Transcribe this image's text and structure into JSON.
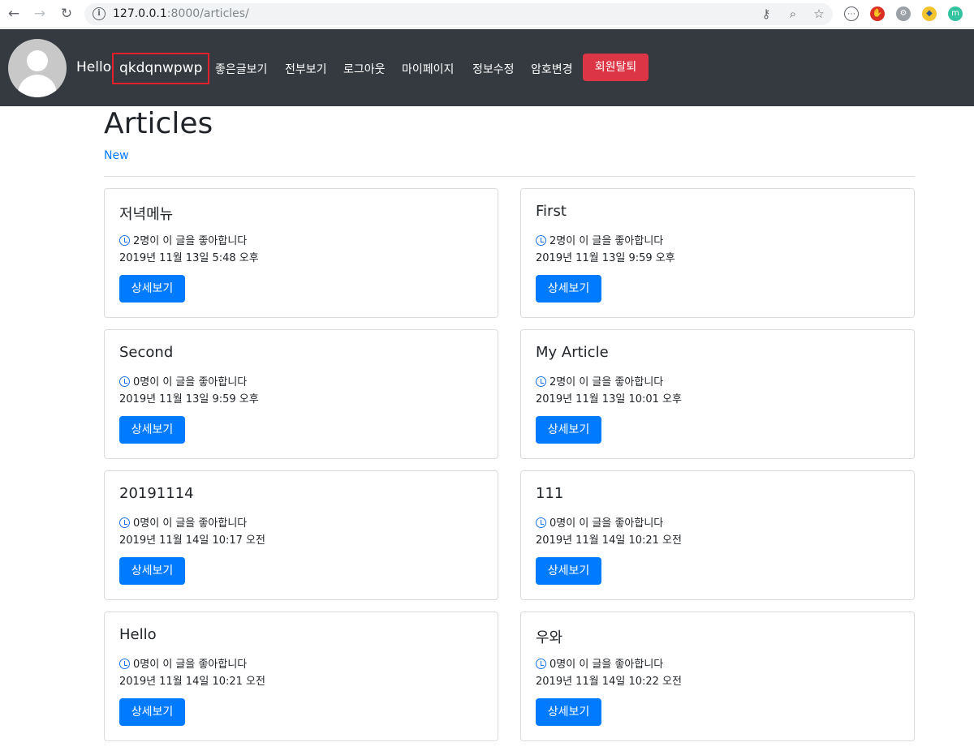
{
  "browser": {
    "url_host": "127.0.0.1",
    "url_rest": ":8000/articles/"
  },
  "navbar": {
    "hello": "Hello",
    "username": "qkdqnwpwp",
    "links": [
      "좋은글보기",
      "전부보기",
      "로그아웃",
      "마이페이지",
      "정보수정",
      "암호변경"
    ],
    "delete_label": "회원탈퇴"
  },
  "main": {
    "title": "Articles",
    "new_label": "New"
  },
  "articles": [
    {
      "title": "저녁메뉴",
      "likes": "2명이 이 글을 좋아합니다",
      "date": "2019년 11월 13일 5:48 오후",
      "button": "상세보기"
    },
    {
      "title": "First",
      "likes": "2명이 이 글을 좋아합니다",
      "date": "2019년 11월 13일 9:59 오후",
      "button": "상세보기"
    },
    {
      "title": "Second",
      "likes": "0명이 이 글을 좋아합니다",
      "date": "2019년 11월 13일 9:59 오후",
      "button": "상세보기"
    },
    {
      "title": "My Article",
      "likes": "2명이 이 글을 좋아합니다",
      "date": "2019년 11월 13일 10:01 오후",
      "button": "상세보기"
    },
    {
      "title": "20191114",
      "likes": "0명이 이 글을 좋아합니다",
      "date": "2019년 11월 14일 10:17 오전",
      "button": "상세보기"
    },
    {
      "title": "111",
      "likes": "0명이 이 글을 좋아합니다",
      "date": "2019년 11월 14일 10:21 오전",
      "button": "상세보기"
    },
    {
      "title": "Hello",
      "likes": "0명이 이 글을 좋아합니다",
      "date": "2019년 11월 14일 10:21 오전",
      "button": "상세보기"
    },
    {
      "title": "우와",
      "likes": "0명이 이 글을 좋아합니다",
      "date": "2019년 11월 14일 10:22 오전",
      "button": "상세보기"
    }
  ],
  "colors": {
    "navbar_bg": "#343a40",
    "primary": "#007bff",
    "danger": "#dc3545",
    "highlight_border": "#e0202a"
  }
}
